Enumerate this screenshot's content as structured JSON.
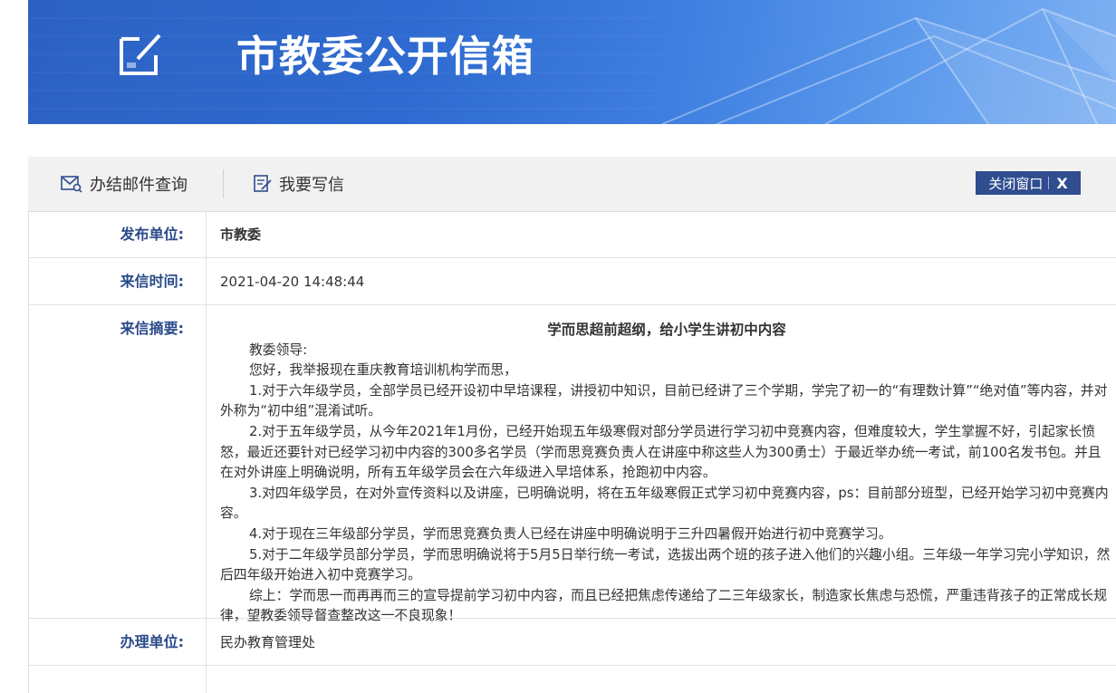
{
  "banner": {
    "title": "市教委公开信箱"
  },
  "toolbar": {
    "query_label": "办结邮件查询",
    "write_label": "我要写信",
    "close_label": "关闭窗口",
    "close_x": "X"
  },
  "colors": {
    "banner_blue": "#2e6ad0",
    "label_blue": "#2a4a8a",
    "close_button": "#2f4d8f"
  },
  "letter": {
    "publisher_label": "发布单位:",
    "publisher_value": "市教委",
    "time_label": "来信时间:",
    "time_value": "2021-04-20 14:48:44",
    "summary_label": "来信摘要:",
    "summary_title": "学而思超前超纲，给小学生讲初中内容",
    "paragraphs": [
      "教委领导:",
      "您好，我举报现在重庆教育培训机构学而思，",
      "1.对于六年级学员，全部学员已经开设初中早培课程，讲授初中知识，目前已经讲了三个学期，学完了初一的“有理数计算”“绝对值”等内容，并对外称为“初中组”混淆试听。",
      "2.对于五年级学员，从今年2021年1月份，已经开始现五年级寒假对部分学员进行学习初中竞赛内容，但难度较大，学生掌握不好，引起家长愤怒，最近还要针对已经学习初中内容的300多名学员（学而思竞赛负责人在讲座中称这些人为300勇士）于最近举办统一考试，前100名发书包。并且在对外讲座上明确说明，所有五年级学员会在六年级进入早培体系，抢跑初中内容。",
      "3.对四年级学员，在对外宣传资料以及讲座，已明确说明，将在五年级寒假正式学习初中竞赛内容，ps：目前部分班型，已经开始学习初中竞赛内容。",
      "4.对于现在三年级部分学员，学而思竞赛负责人已经在讲座中明确说明于三升四暑假开始进行初中竞赛学习。",
      "5.对于二年级学员部分学员，学而思明确说将于5月5日举行统一考试，选拔出两个班的孩子进入他们的兴趣小组。三年级一年学习完小学知识，然后四年级开始进入初中竞赛学习。",
      "综上：学而思一而再再而三的宣导提前学习初中内容，而且已经把焦虑传递给了二三年级家长，制造家长焦虑与恐慌，严重违背孩子的正常成长规律，望教委领导督查整改这一不良现象！"
    ],
    "dept_label": "办理单位:",
    "dept_value": "民办教育管理处"
  }
}
